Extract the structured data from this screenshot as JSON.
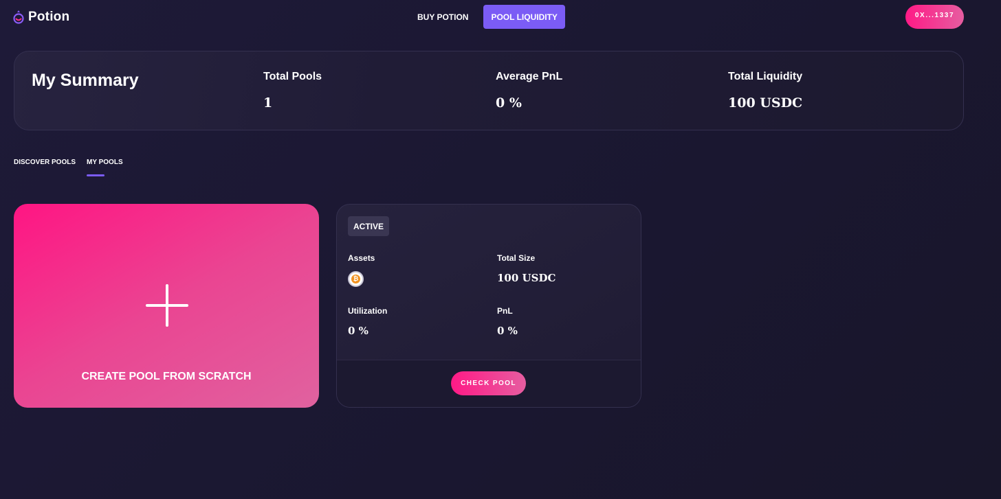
{
  "header": {
    "brand": "Potion",
    "nav": [
      {
        "label": "BUY POTION",
        "active": false
      },
      {
        "label": "POOL LIQUIDITY",
        "active": true
      }
    ],
    "wallet_label": "0X...1337"
  },
  "summary": {
    "title": "My Summary",
    "stats": [
      {
        "label": "Total Pools",
        "value": "1"
      },
      {
        "label": "Average PnL",
        "value": "0 %"
      },
      {
        "label": "Total Liquidity",
        "value": "100 USDC"
      }
    ]
  },
  "tabs": [
    {
      "label": "DISCOVER POOLS",
      "active": false
    },
    {
      "label": "MY POOLS",
      "active": true
    }
  ],
  "create_card": {
    "label": "CREATE POOL FROM SCRATCH",
    "icon": "plus-icon"
  },
  "pool_card": {
    "status": "ACTIVE",
    "assets_label": "Assets",
    "asset_icon": "bitcoin-icon",
    "asset_symbol": "₿",
    "total_size_label": "Total Size",
    "total_size": "100 USDC",
    "utilization_label": "Utilization",
    "utilization": "0 %",
    "pnl_label": "PnL",
    "pnl": "0 %",
    "button_label": "CHECK POOL"
  },
  "colors": {
    "background": "#1b1831",
    "accent_purple": "#7b5cf5",
    "accent_pink": "#ff1a86"
  }
}
